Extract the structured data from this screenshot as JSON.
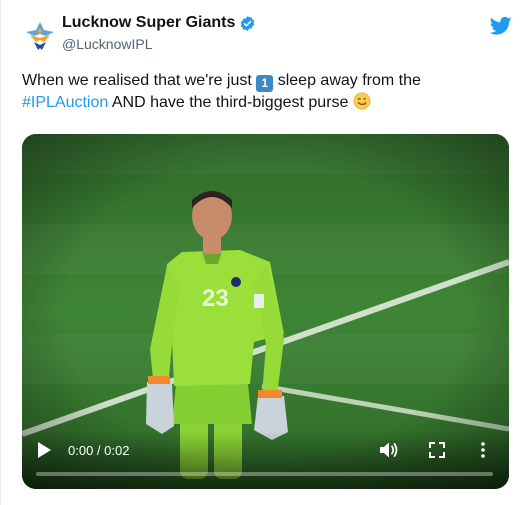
{
  "account": {
    "display_name": "Lucknow Super Giants",
    "handle": "@LucknowIPL",
    "verified": true,
    "avatar_icon": "lsg-logo-icon"
  },
  "tweet": {
    "text_before": "When we realised that we're just ",
    "keycap": "1",
    "text_after_keycap": " sleep away from the",
    "hashtag": "#IPLAuction",
    "text_end": " AND have the third-biggest purse ",
    "emoji": "face-savoring-food-icon"
  },
  "video": {
    "jersey_number": "23",
    "time_display": "0:00 / 0:02",
    "progress": 0
  },
  "colors": {
    "brand_blue": "#1d9bf0",
    "pitch_green": "#3d7d33",
    "jersey": "#9be03a"
  }
}
